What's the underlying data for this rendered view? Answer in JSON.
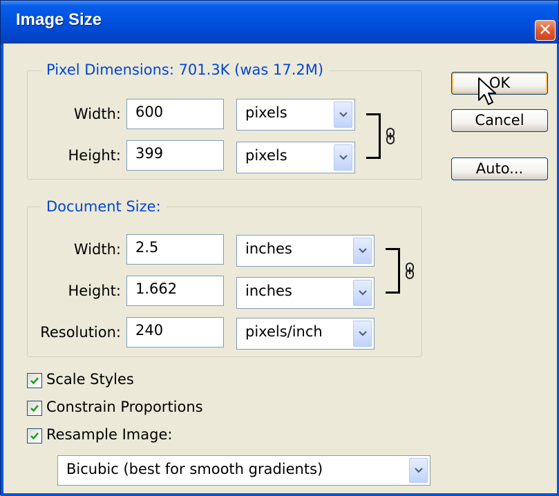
{
  "dialog": {
    "title": "Image Size",
    "close_glyph": "✕"
  },
  "pixel_dimensions": {
    "legend": "Pixel Dimensions:  701.3K (was 17.2M)",
    "width_label": "Width:",
    "width_value": "600",
    "width_unit": "pixels",
    "height_label": "Height:",
    "height_value": "399",
    "height_unit": "pixels"
  },
  "document_size": {
    "legend": "Document Size:",
    "width_label": "Width:",
    "width_value": "2.5",
    "width_unit": "inches",
    "height_label": "Height:",
    "height_value": "1.662",
    "height_unit": "inches",
    "resolution_label": "Resolution:",
    "resolution_value": "240",
    "resolution_unit": "pixels/inch"
  },
  "buttons": {
    "ok": "OK",
    "cancel": "Cancel",
    "auto": "Auto..."
  },
  "options": {
    "scale_styles": {
      "label": "Scale Styles",
      "checked": true
    },
    "constrain_proportions": {
      "label": "Constrain Proportions",
      "checked": true
    },
    "resample_image": {
      "label": "Resample Image:",
      "checked": true
    }
  },
  "resample_method": "Bicubic (best for smooth gradients)",
  "colors": {
    "titlebar": "#0054e3",
    "dialog_bg": "#ece9d8",
    "legend_text": "#0046d5",
    "close_button": "#e05b2f"
  },
  "icons": [
    "close-icon",
    "link-chain-icon",
    "dropdown-arrow-icon",
    "checkmark-icon",
    "mouse-cursor-icon"
  ]
}
